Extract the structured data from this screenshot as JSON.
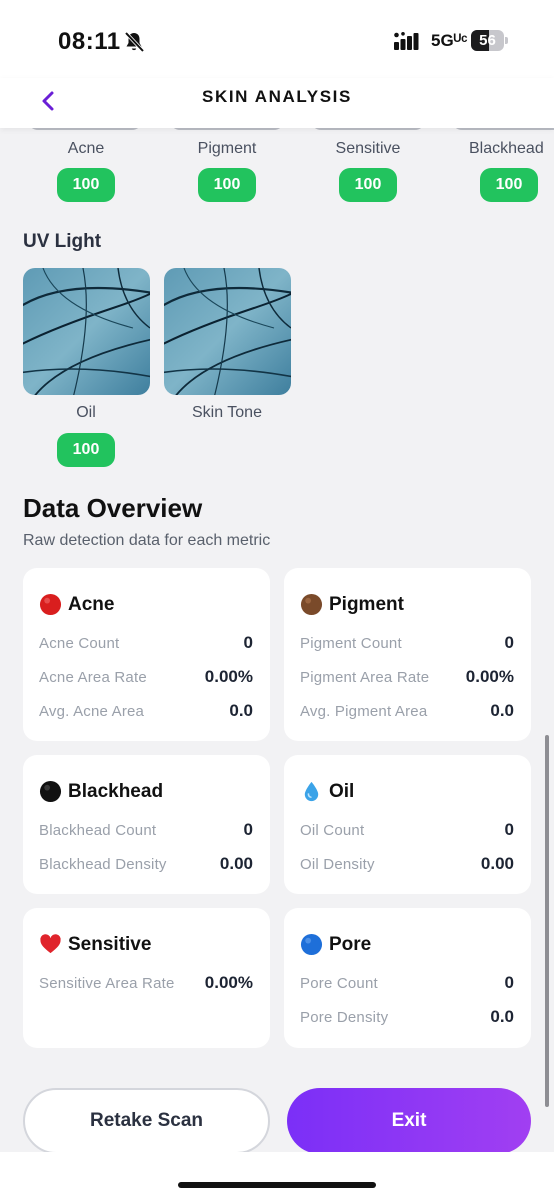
{
  "status_bar": {
    "time": "08:11",
    "network": "5Gᵁᶜ",
    "battery": "56",
    "battery_level": 0.56
  },
  "header": {
    "title": "SKIN ANALYSIS",
    "back_icon": "chevron-left-icon",
    "accent_color": "#6a1fd6"
  },
  "top_metrics": [
    {
      "label": "Acne",
      "score": "100"
    },
    {
      "label": "Pigment",
      "score": "100"
    },
    {
      "label": "Sensitive",
      "score": "100"
    },
    {
      "label": "Blackhead",
      "score": "100"
    }
  ],
  "uv_section": {
    "title": "UV Light",
    "items": [
      {
        "label": "Oil",
        "score": "100"
      },
      {
        "label": "Skin Tone",
        "score": ""
      }
    ]
  },
  "overview": {
    "title": "Data Overview",
    "subtitle": "Raw detection data for each metric",
    "cards": [
      {
        "title": "Acne",
        "icon": "red-circle-icon",
        "rows": [
          {
            "label": "Acne Count",
            "value": "0"
          },
          {
            "label": "Acne Area Rate",
            "value": "0.00%"
          },
          {
            "label": "Avg. Acne Area",
            "value": "0.0"
          }
        ]
      },
      {
        "title": "Pigment",
        "icon": "brown-circle-icon",
        "rows": [
          {
            "label": "Pigment Count",
            "value": "0"
          },
          {
            "label": "Pigment Area Rate",
            "value": "0.00%"
          },
          {
            "label": "Avg. Pigment Area",
            "value": "0.0"
          }
        ]
      },
      {
        "title": "Blackhead",
        "icon": "black-circle-icon",
        "rows": [
          {
            "label": "Blackhead Count",
            "value": "0"
          },
          {
            "label": "Blackhead Density",
            "value": "0.00"
          }
        ]
      },
      {
        "title": "Oil",
        "icon": "droplet-icon",
        "rows": [
          {
            "label": "Oil Count",
            "value": "0"
          },
          {
            "label": "Oil Density",
            "value": "0.00"
          }
        ]
      },
      {
        "title": "Sensitive",
        "icon": "red-heart-icon",
        "rows": [
          {
            "label": "Sensitive Area Rate",
            "value": "0.00%"
          }
        ]
      },
      {
        "title": "Pore",
        "icon": "blue-circle-icon",
        "rows": [
          {
            "label": "Pore Count",
            "value": "0"
          },
          {
            "label": "Pore Density",
            "value": "0.0"
          }
        ]
      }
    ]
  },
  "actions": {
    "retake": "Retake Scan",
    "exit": "Exit"
  },
  "colors": {
    "badge_green": "#22c35e",
    "exit_gradient_start": "#7b2ff7",
    "exit_gradient_end": "#a13ff2",
    "background": "#f2f2f4"
  }
}
